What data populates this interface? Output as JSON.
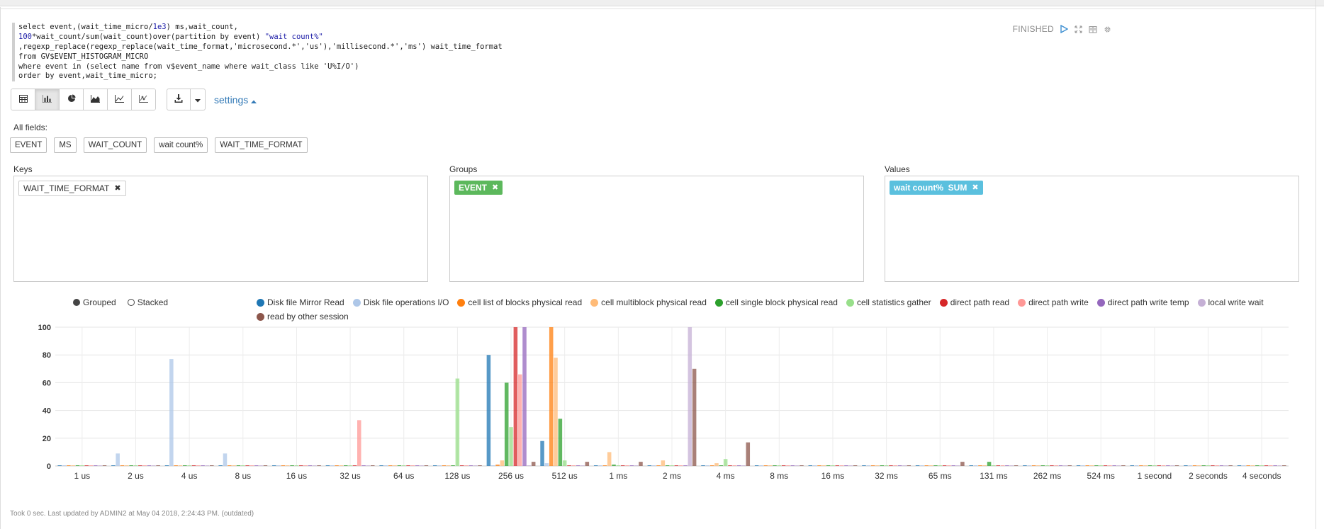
{
  "paragraph": {
    "status": "FINISHED",
    "query_lines": [
      [
        "select event,(wait_time_micro/",
        {
          "t": "1e3",
          "c": "blue"
        },
        ") ms,wait_count,"
      ],
      [
        {
          "t": "100",
          "c": "blue"
        },
        "*wait_count/sum(wait_count)over(partition by event) ",
        {
          "t": "\"wait count%\"",
          "c": "blue"
        }
      ],
      [
        ",regexp_replace(regexp_replace(wait_time_format,'microsecond.*','us'),'millisecond.*','ms') wait_time_format"
      ],
      [
        "from GV$EVENT_HISTOGRAM_MICRO"
      ],
      [
        "where event in (select name from v$event_name where wait_class like 'U%I/O')"
      ],
      [
        "order by event,wait_time_micro;"
      ]
    ]
  },
  "toolbar": {
    "view_buttons": [
      {
        "name": "table-view-button",
        "icon": "table-icon"
      },
      {
        "name": "bar-chart-view-button",
        "icon": "bar-chart-icon",
        "active": true
      },
      {
        "name": "pie-chart-view-button",
        "icon": "pie-chart-icon"
      },
      {
        "name": "area-chart-view-button",
        "icon": "area-chart-icon"
      },
      {
        "name": "line-chart-view-button",
        "icon": "line-chart-icon"
      },
      {
        "name": "scatter-chart-view-button",
        "icon": "scatter-chart-icon"
      }
    ],
    "settings_label": "settings"
  },
  "fields": {
    "label": "All fields:",
    "items": [
      "EVENT",
      "MS",
      "WAIT_COUNT",
      "wait count%",
      "WAIT_TIME_FORMAT"
    ]
  },
  "keys": {
    "label": "Keys",
    "chips": [
      "WAIT_TIME_FORMAT"
    ]
  },
  "groups": {
    "label": "Groups",
    "chips": [
      "EVENT"
    ]
  },
  "values": {
    "label": "Values",
    "chips": [
      "wait count%  SUM"
    ]
  },
  "chart_modes": {
    "grouped": "Grouped",
    "stacked": "Stacked",
    "selected": "grouped"
  },
  "footer": "Took 0 sec. Last updated by ADMIN2 at May 04 2018, 2:24:43 PM. (outdated)",
  "chart_data": {
    "type": "bar",
    "ylim": [
      0,
      100
    ],
    "yticks": [
      0,
      20,
      40,
      60,
      80,
      100
    ],
    "grid": true,
    "legend_position": "top",
    "categories": [
      "1 us",
      "2 us",
      "4 us",
      "8 us",
      "16 us",
      "32 us",
      "64 us",
      "128 us",
      "256 us",
      "512 us",
      "1 ms",
      "2 ms",
      "4 ms",
      "8 ms",
      "16 ms",
      "32 ms",
      "65 ms",
      "131 ms",
      "262 ms",
      "524 ms",
      "1 second",
      "2 seconds",
      "4 seconds"
    ],
    "series": [
      {
        "name": "Disk file Mirror Read",
        "color": "#1f77b4",
        "values": [
          0,
          0,
          0,
          0,
          0,
          0,
          0,
          0,
          80,
          18,
          0,
          0,
          0,
          0,
          0,
          0,
          0,
          0,
          0,
          0,
          0,
          0,
          0
        ]
      },
      {
        "name": "Disk file operations I/O",
        "color": "#aec7e8",
        "values": [
          0,
          9,
          77,
          9,
          0,
          0,
          0,
          0,
          0,
          2,
          0,
          0,
          0,
          0,
          0,
          0,
          0,
          0,
          0,
          0,
          0,
          0,
          0
        ]
      },
      {
        "name": "cell list of blocks physical read",
        "color": "#ff7f0e",
        "values": [
          0,
          0,
          0,
          0,
          0,
          0,
          0,
          0,
          1,
          100,
          0,
          0,
          0,
          0,
          0,
          0,
          0,
          0,
          0,
          0,
          0,
          0,
          0
        ]
      },
      {
        "name": "cell multiblock physical read",
        "color": "#ffbb78",
        "values": [
          0,
          0,
          0,
          0,
          0,
          0,
          0,
          0,
          4,
          78,
          10,
          4,
          2,
          0,
          0,
          0,
          0,
          0,
          0,
          0,
          0,
          0,
          0
        ]
      },
      {
        "name": "cell single block physical read",
        "color": "#2ca02c",
        "values": [
          0,
          0,
          0,
          0,
          0,
          0,
          0,
          0,
          60,
          34,
          1,
          0,
          0.5,
          0.5,
          0.5,
          0.5,
          0.5,
          3,
          0.3,
          0.2,
          0.2,
          0.2,
          0.2
        ]
      },
      {
        "name": "cell statistics gather",
        "color": "#98df8a",
        "values": [
          0,
          0,
          0,
          0,
          0,
          0,
          0,
          63,
          28,
          4,
          0,
          0,
          5,
          0,
          0,
          0,
          0,
          0,
          0,
          0,
          0,
          0,
          0
        ]
      },
      {
        "name": "direct path read",
        "color": "#d62728",
        "values": [
          0,
          0,
          0,
          0,
          0,
          0,
          0,
          0,
          100,
          0,
          0,
          0,
          0,
          0,
          0,
          0,
          0,
          0,
          0,
          0,
          0,
          0,
          0
        ]
      },
      {
        "name": "direct path write",
        "color": "#ff9896",
        "values": [
          0,
          0,
          0,
          0,
          0,
          33,
          0,
          0,
          66,
          0,
          0,
          0,
          0,
          0,
          0,
          0,
          0,
          0,
          0,
          0,
          0,
          0,
          0
        ]
      },
      {
        "name": "direct path write temp",
        "color": "#9467bd",
        "values": [
          0,
          0,
          0,
          0,
          0,
          0,
          0,
          0,
          100,
          0,
          0,
          0,
          0,
          0,
          0,
          0,
          0,
          0,
          0,
          0,
          0,
          0,
          0
        ]
      },
      {
        "name": "local write wait",
        "color": "#c5b0d5",
        "values": [
          0,
          0,
          0,
          0,
          0,
          0,
          0,
          0,
          0,
          0,
          0,
          100,
          0,
          0,
          0,
          0,
          0,
          0,
          0,
          0,
          0,
          0,
          0
        ]
      },
      {
        "name": "read by other session",
        "color": "#8c564b",
        "values": [
          0,
          0,
          0,
          0,
          0,
          0,
          0,
          0,
          3,
          3,
          3,
          70,
          17,
          0.3,
          0,
          0,
          3,
          0,
          0,
          0,
          0,
          0,
          0
        ]
      }
    ]
  }
}
